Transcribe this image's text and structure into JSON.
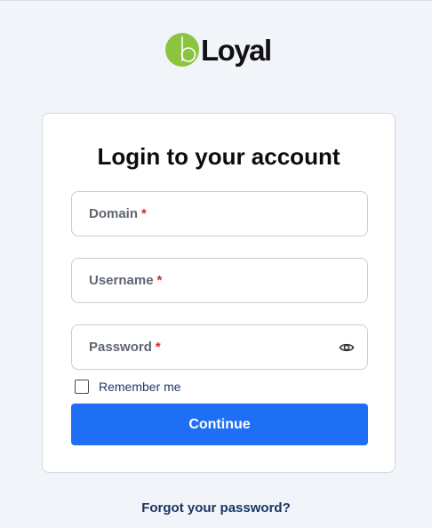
{
  "logo": {
    "mark_letter": "b",
    "word": "Loyal",
    "mark_color": "#8bc53f"
  },
  "card": {
    "title": "Login to your account"
  },
  "fields": {
    "domain": {
      "placeholder": "Domain",
      "required_mark": "*"
    },
    "username": {
      "placeholder": "Username",
      "required_mark": "*"
    },
    "password": {
      "placeholder": "Password",
      "required_mark": "*",
      "toggle_icon": "eye-icon"
    }
  },
  "remember": {
    "label": "Remember me",
    "checked": false
  },
  "actions": {
    "continue_label": "Continue",
    "continue_color": "#1f6ff4",
    "forgot_label": "Forgot your password?"
  }
}
